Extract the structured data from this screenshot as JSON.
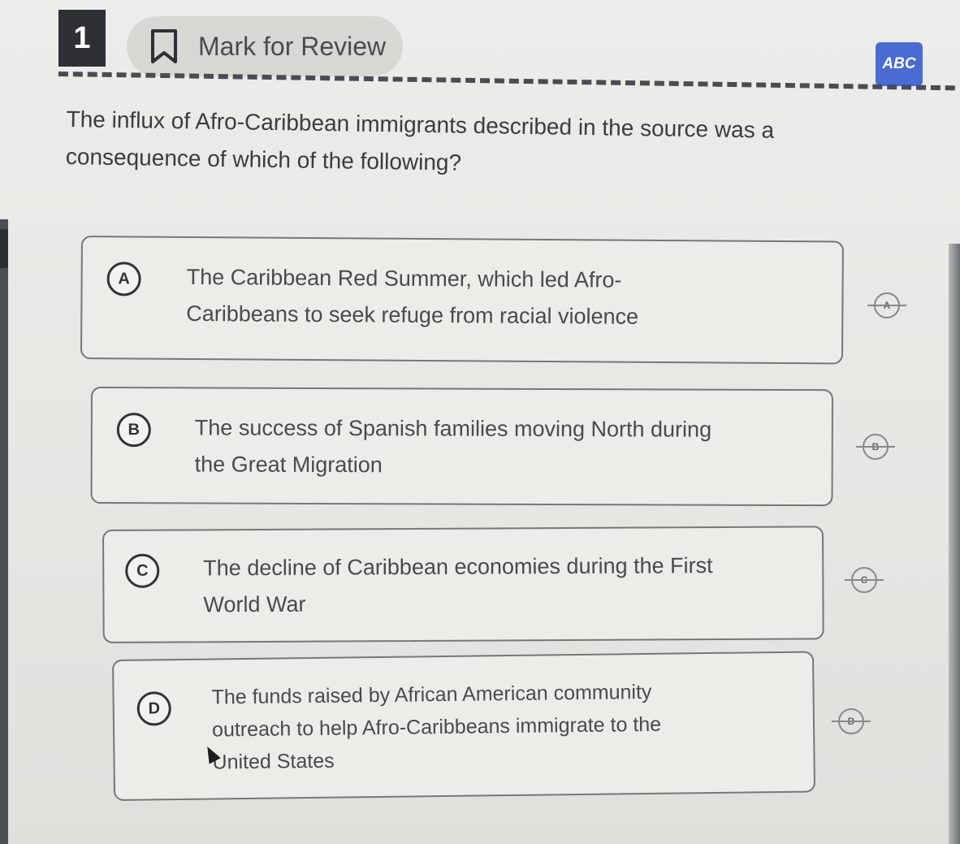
{
  "question_number": "1",
  "mark_for_review": {
    "label": "Mark for Review",
    "icon": "bookmark-icon"
  },
  "toolbar": {
    "strikethrough_label": "ABC"
  },
  "question": {
    "line1": "The influx of Afro-Caribbean immigrants described in the source was a",
    "line2": "consequence of which of the following?"
  },
  "choices": [
    {
      "letter": "A",
      "lines": [
        "The Caribbean Red Summer, which led Afro-",
        "Caribbeans to seek refuge from racial violence"
      ],
      "strike_label": "A"
    },
    {
      "letter": "B",
      "lines": [
        "The success of Spanish families moving North during",
        "the Great Migration"
      ],
      "strike_label": "B"
    },
    {
      "letter": "C",
      "lines": [
        "The decline of Caribbean economies during the First",
        "World War"
      ],
      "strike_label": "C"
    },
    {
      "letter": "D",
      "lines": [
        "The funds raised by African American community",
        "outreach to help Afro-Caribbeans immigrate to the",
        "United States"
      ],
      "strike_label": "D"
    }
  ]
}
